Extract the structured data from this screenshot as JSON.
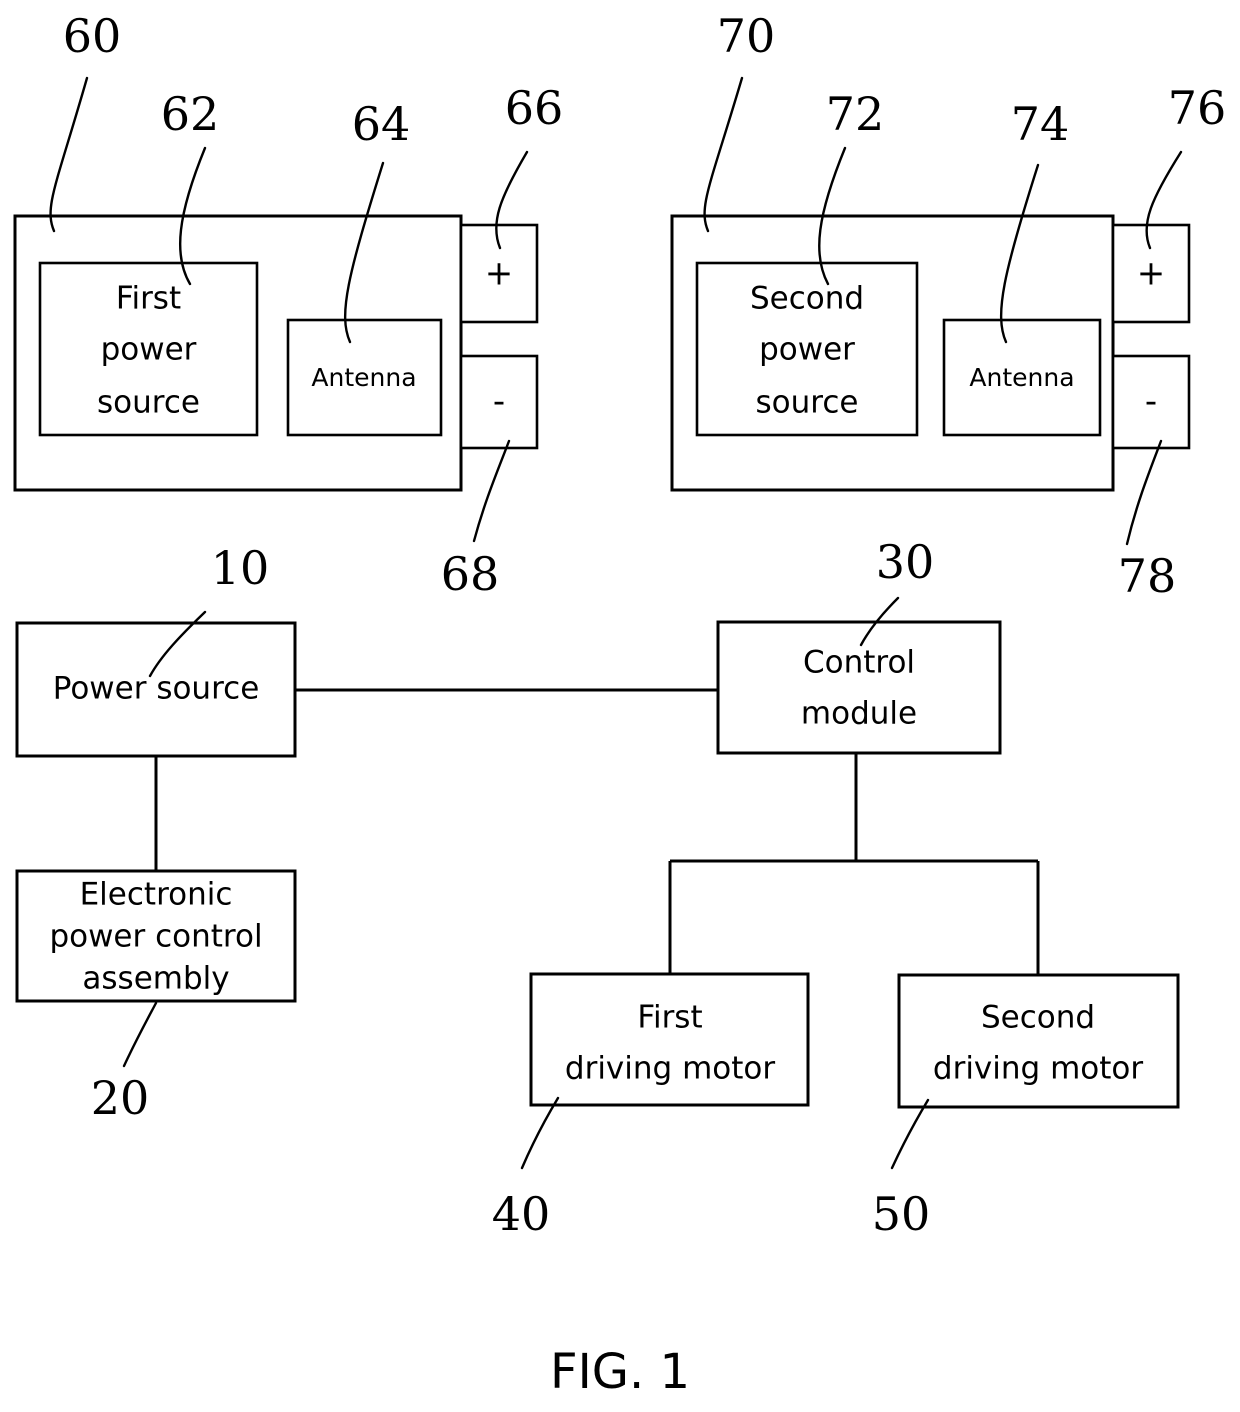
{
  "figure": {
    "caption": "FIG. 1",
    "blocks": {
      "first_battery_pack": "",
      "first_power_source": "First\npower\nsource",
      "first_power_source_l1": "First",
      "first_power_source_l2": "power",
      "first_power_source_l3": "source",
      "first_antenna": "Antenna",
      "first_positive_terminal": "+",
      "first_negative_terminal": "-",
      "second_battery_pack": "",
      "second_power_source_l1": "Second",
      "second_power_source_l2": "power",
      "second_power_source_l3": "source",
      "second_antenna": "Antenna",
      "second_positive_terminal": "+",
      "second_negative_terminal": "-",
      "power_source": "Power source",
      "electronic_power_control_assembly_l1": "Electronic",
      "electronic_power_control_assembly_l2": "power control",
      "electronic_power_control_assembly_l3": "assembly",
      "control_module_l1": "Control",
      "control_module_l2": "module",
      "first_driving_motor_l1": "First",
      "first_driving_motor_l2": "driving motor",
      "second_driving_motor_l1": "Second",
      "second_driving_motor_l2": "driving motor"
    },
    "reference_numerals": {
      "power_source": "10",
      "electronic_power_control_assembly": "20",
      "control_module": "30",
      "first_driving_motor": "40",
      "second_driving_motor": "50",
      "first_battery_pack": "60",
      "first_power_source": "62",
      "first_antenna": "64",
      "first_positive_terminal": "66",
      "first_negative_terminal": "68",
      "second_battery_pack": "70",
      "second_power_source": "72",
      "second_antenna": "74",
      "second_positive_terminal": "76",
      "second_negative_terminal": "78"
    },
    "colors": {
      "line": "#000000",
      "fill": "#ffffff",
      "text": "#000000"
    }
  }
}
